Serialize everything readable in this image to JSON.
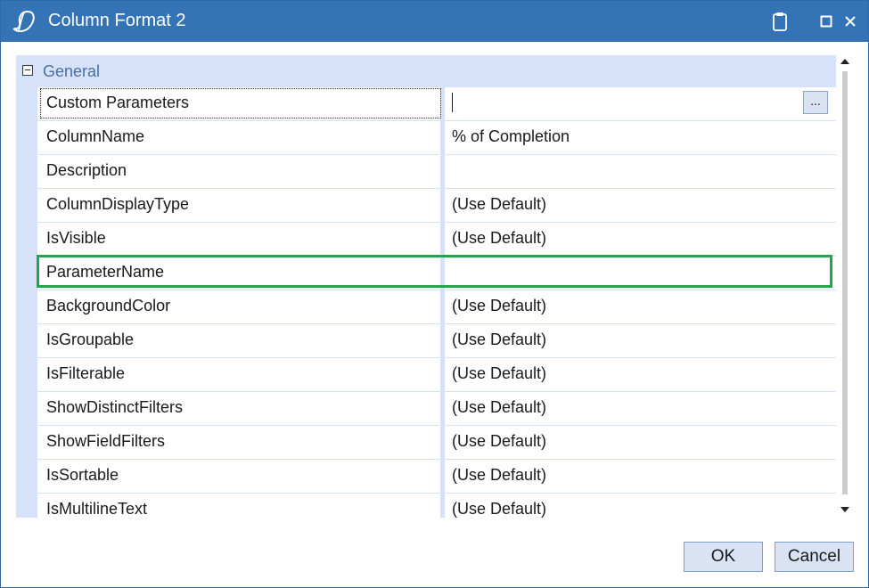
{
  "window": {
    "title": "Column Format 2"
  },
  "grid": {
    "category": "General",
    "rows": [
      {
        "name": "Custom Parameters",
        "value": ""
      },
      {
        "name": "ColumnName",
        "value": "% of Completion"
      },
      {
        "name": "Description",
        "value": ""
      },
      {
        "name": "ColumnDisplayType",
        "value": "(Use Default)"
      },
      {
        "name": "IsVisible",
        "value": "(Use Default)"
      },
      {
        "name": "ParameterName",
        "value": ""
      },
      {
        "name": "BackgroundColor",
        "value": "(Use Default)"
      },
      {
        "name": "IsGroupable",
        "value": "(Use Default)"
      },
      {
        "name": "IsFilterable",
        "value": "(Use Default)"
      },
      {
        "name": "ShowDistinctFilters",
        "value": "(Use Default)"
      },
      {
        "name": "ShowFieldFilters",
        "value": "(Use Default)"
      },
      {
        "name": "IsSortable",
        "value": "(Use Default)"
      },
      {
        "name": "IsMultilineText",
        "value": "(Use Default)"
      }
    ],
    "ellipsis_label": "...",
    "highlight_color": "#22a64a"
  },
  "buttons": {
    "ok": "OK",
    "cancel": "Cancel"
  },
  "colors": {
    "titlebar": "#3473b5",
    "grid_accent": "#d6e2f7"
  }
}
